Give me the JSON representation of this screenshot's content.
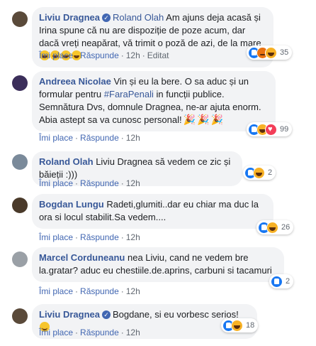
{
  "comments": [
    {
      "author": "Liviu Dragnea",
      "verified": true,
      "mention": "Roland Olah",
      "text": "Am ajuns deja acasă și Irina spune că nu are dispoziție de poze acum, dar dacă vreți neapărat, vă trimit o poză de azi, de la mare",
      "emojis": [
        "haha",
        "haha",
        "haha",
        "haha"
      ],
      "actions": {
        "like": "Îmi place",
        "reply": "Răspunde",
        "time": "12h",
        "edited": "Editat"
      },
      "reactions": [
        "like",
        "angry",
        "haha"
      ],
      "count": "35",
      "avatar_color": "#5a4a3a"
    },
    {
      "author": "Andreea Nicolae",
      "text_before": "Vin și eu la bere. O sa aduc și un formular pentru",
      "hashtag": "#FaraPenali",
      "text_after": "in funcții publice. Semnătura Dvs, domnule Dragnea, ne-ar ajuta enorm.",
      "text_line2": "Abia astept sa va cunosc personal!",
      "emojis": [
        "party",
        "party",
        "party"
      ],
      "actions": {
        "like": "Îmi place",
        "reply": "Răspunde",
        "time": "12h"
      },
      "reactions": [
        "like",
        "haha",
        "love"
      ],
      "count": "99",
      "avatar_color": "#3b2e5a"
    },
    {
      "author": "Roland Olah",
      "text": "Liviu Dragnea să vedem ce zic și băieții :)))",
      "actions": {
        "like": "Îmi place",
        "reply": "Răspunde",
        "time": "12h"
      },
      "reactions": [
        "like",
        "haha"
      ],
      "count": "2",
      "avatar_color": "#7a8a9a"
    },
    {
      "author": "Bogdan Lungu",
      "text": "Radeti,glumiti..dar eu chiar ma duc la ora si locul stabilit.Sa vedem....",
      "actions": {
        "like": "Îmi place",
        "reply": "Răspunde",
        "time": "12h"
      },
      "reactions": [
        "like",
        "haha"
      ],
      "count": "26",
      "avatar_color": "#4a3a2a"
    },
    {
      "author": "Marcel Corduneanu",
      "text": "nea Liviu, cand ne vedem bre la.gratar? aduc eu chestiile.de.aprins, carbuni si tacamuri",
      "actions": {
        "like": "Îmi place",
        "reply": "Răspunde",
        "time": "12h"
      },
      "reactions": [
        "like"
      ],
      "count": "2",
      "avatar_color": "#9aa0a6"
    },
    {
      "author": "Liviu Dragnea",
      "verified": true,
      "text": "Bogdane, si eu vorbesc serios!",
      "emojis": [
        "smile"
      ],
      "actions": {
        "like": "Îmi place",
        "reply": "Răspunde",
        "time": "12h"
      },
      "reactions": [
        "like",
        "haha"
      ],
      "count": "18",
      "avatar_color": "#5a4a3a"
    }
  ]
}
